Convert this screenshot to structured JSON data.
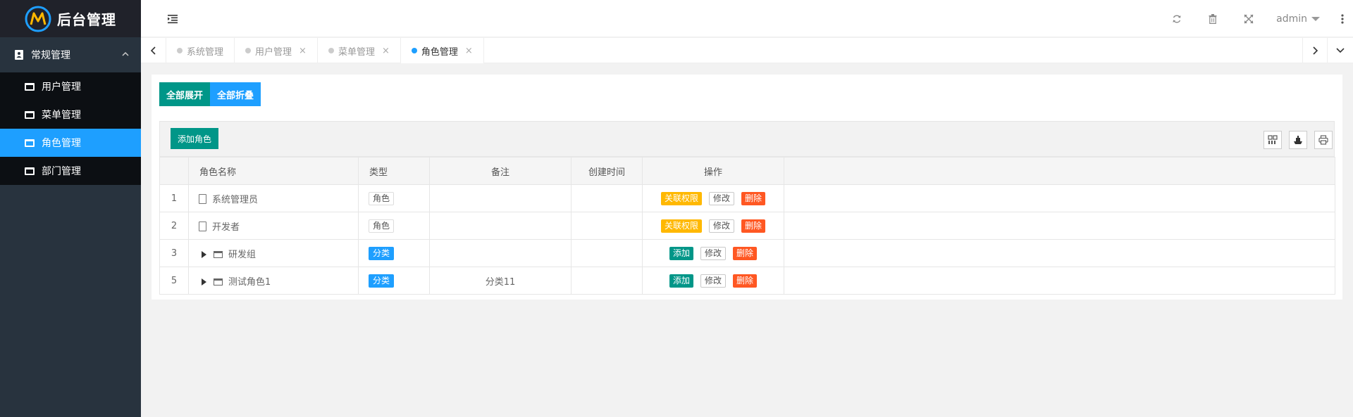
{
  "app": {
    "title": "后台管理"
  },
  "sidebar": {
    "group": {
      "label": "常规管理"
    },
    "items": [
      {
        "label": "用户管理"
      },
      {
        "label": "菜单管理"
      },
      {
        "label": "角色管理",
        "active": true
      },
      {
        "label": "部门管理"
      }
    ]
  },
  "header": {
    "user": "admin"
  },
  "tabs": [
    {
      "label": "系统管理",
      "closable": false
    },
    {
      "label": "用户管理",
      "closable": true
    },
    {
      "label": "菜单管理",
      "closable": true
    },
    {
      "label": "角色管理",
      "closable": true,
      "active": true
    }
  ],
  "tab_close_glyph": "×",
  "buttons": {
    "expand_all": "全部展开",
    "collapse_all": "全部折叠",
    "add_role": "添加角色"
  },
  "table": {
    "columns": [
      "",
      "角色名称",
      "类型",
      "备注",
      "创建时间",
      "操作"
    ],
    "rows": [
      {
        "num": "1",
        "name": "系统管理员",
        "type": "角色",
        "remark": "",
        "created": "",
        "kind": "role",
        "actions": [
          "关联权限",
          "修改",
          "删除"
        ]
      },
      {
        "num": "2",
        "name": "开发者",
        "type": "角色",
        "remark": "",
        "created": "",
        "kind": "role",
        "actions": [
          "关联权限",
          "修改",
          "删除"
        ]
      },
      {
        "num": "3",
        "name": "研发组",
        "type": "分类",
        "remark": "",
        "created": "",
        "kind": "category",
        "actions": [
          "添加",
          "修改",
          "删除"
        ]
      },
      {
        "num": "5",
        "name": "测试角色1",
        "type": "分类",
        "remark": "分类11",
        "created": "",
        "kind": "category",
        "actions": [
          "添加",
          "修改",
          "删除"
        ]
      }
    ]
  },
  "colors": {
    "primary": "#009688",
    "blue": "#1e9fff",
    "orange": "#ffb800",
    "red": "#ff5722",
    "sidebar": "#28333e"
  }
}
